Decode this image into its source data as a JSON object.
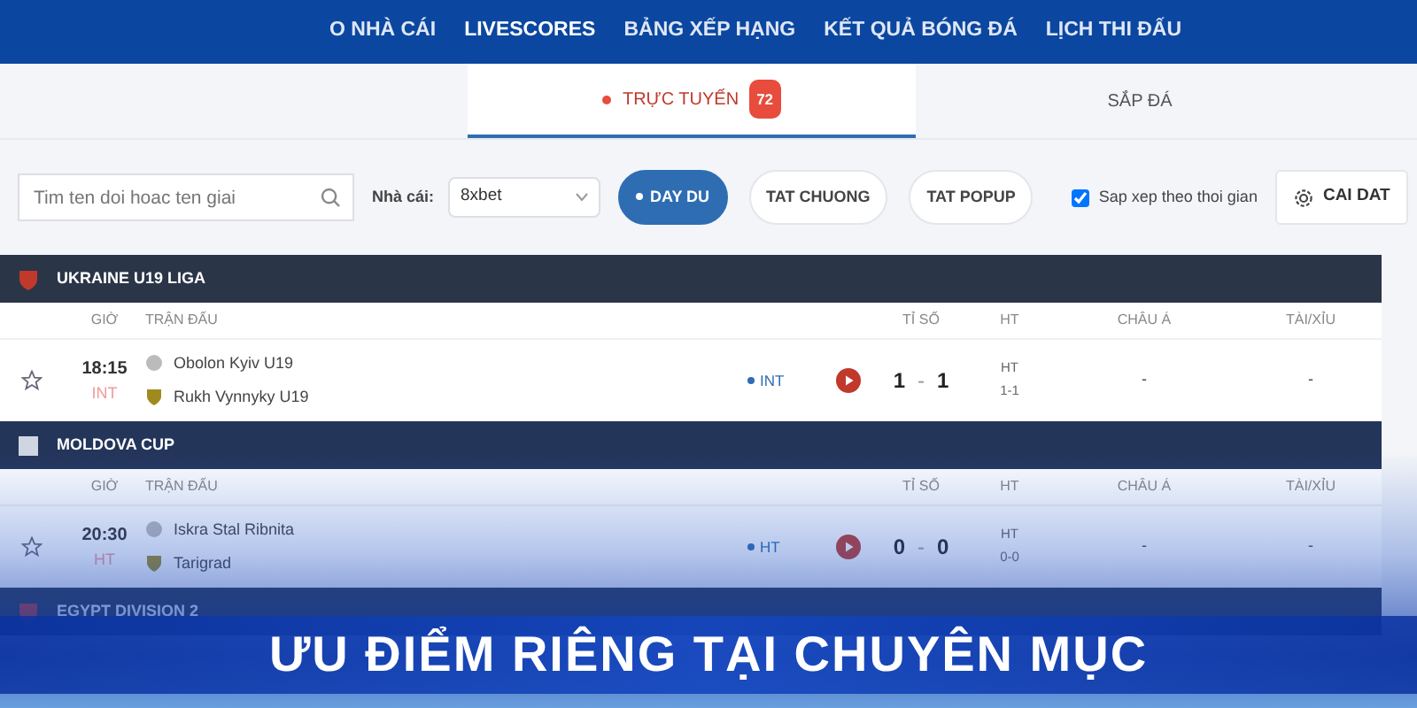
{
  "nav": {
    "items": [
      {
        "label": "O NHÀ CÁI",
        "selected": false
      },
      {
        "label": "LIVESCORES",
        "selected": true
      },
      {
        "label": "BẢNG XẾP HẠNG",
        "selected": false
      },
      {
        "label": "KẾT QUẢ BÓNG ĐÁ",
        "selected": false
      },
      {
        "label": "LỊCH THI ĐẤU",
        "selected": false
      }
    ]
  },
  "tabs": [
    {
      "label": "TRỰC TUYẾN",
      "live": true,
      "badge": "72",
      "selected": true
    },
    {
      "label": "SẮP ĐÁ",
      "live": false,
      "selected": false
    }
  ],
  "filters": {
    "search": {
      "placeholder": "Tim ten doi hoac ten giai"
    },
    "bookmaker_label": "Nhà cái:",
    "bookmaker": "8xbet",
    "buttons": [
      {
        "label": "DAY DU",
        "selected": true
      },
      {
        "label": "TAT CHUONG",
        "selected": false
      },
      {
        "label": "TAT POPUP",
        "selected": false
      }
    ],
    "sort": {
      "label": "Sap xep theo thoi gian",
      "checked": true
    },
    "settings": "CAI DAT"
  },
  "leagues": [
    {
      "name": "UKRAINE U19 LIGA",
      "columns": [
        "GIỜ",
        "TRẬN ĐẤU",
        "TỈ SỐ",
        "HT",
        "CHÂU Á",
        "TÀI/XỈU"
      ],
      "matches": [
        {
          "time": "18:15",
          "status": "INT",
          "home": "Obolon Kyiv U19",
          "away": "Rukh Vynnyky U19",
          "live_label": "INT",
          "score_home": "1",
          "score_sep": "-",
          "score_away": "1",
          "ht_label": "HT",
          "ht_score": "1-1",
          "asian": "-",
          "over_under": "-"
        }
      ]
    },
    {
      "name": "MOLDOVA CUP",
      "columns": [
        "GIỜ",
        "TRẬN ĐẤU",
        "TỈ SỐ",
        "HT",
        "CHÂU Á",
        "TÀI/XỈU"
      ],
      "matches": [
        {
          "time": "20:30",
          "status": "HT",
          "home": "Iskra Stal Ribnita",
          "away": "Tarigrad",
          "live_label": "HT",
          "score_home": "0",
          "score_sep": "-",
          "score_away": "0",
          "ht_label": "HT",
          "ht_score": "0-0",
          "asian": "-",
          "over_under": "-"
        }
      ]
    },
    {
      "name": "EGYPT DIVISION 2"
    }
  ],
  "banner": {
    "title": "ƯU ĐIỂM RIÊNG TẠI CHUYÊN MỤC"
  }
}
